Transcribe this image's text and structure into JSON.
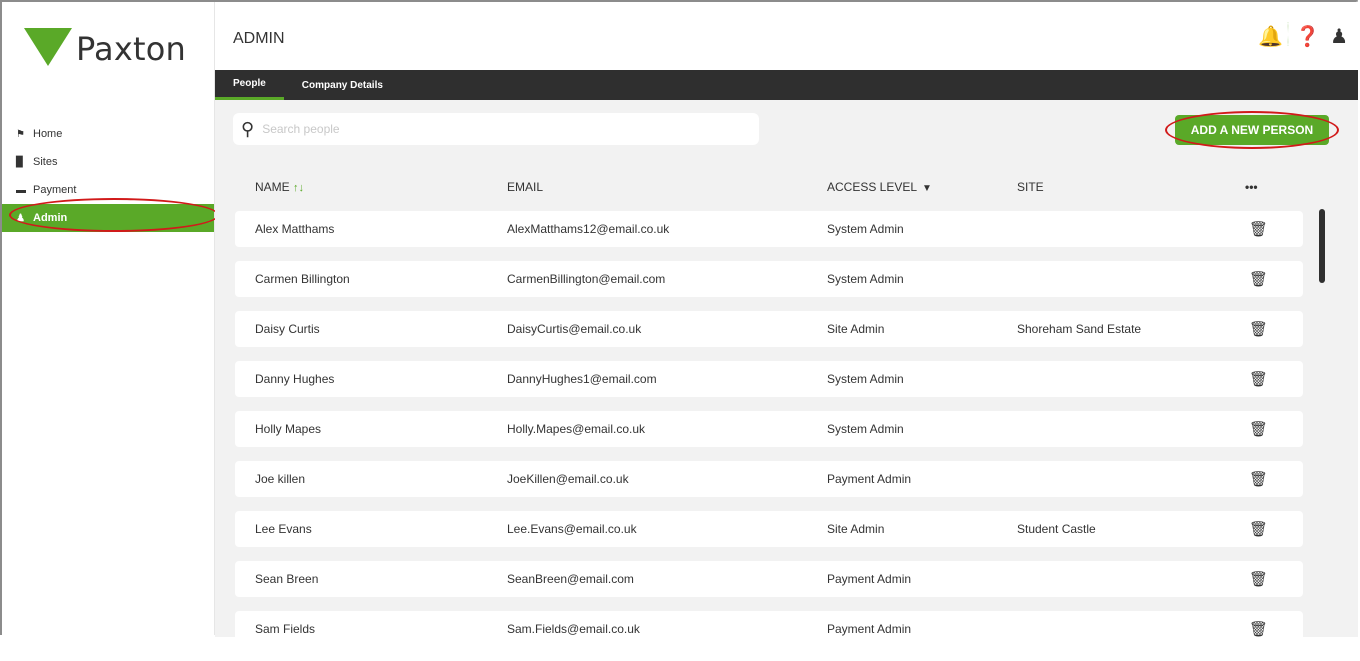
{
  "brand": {
    "name": "Paxton",
    "color": "#5aa928"
  },
  "sidebar": {
    "items": [
      {
        "label": "Home",
        "icon": "home-icon"
      },
      {
        "label": "Sites",
        "icon": "sites-icon"
      },
      {
        "label": "Payment",
        "icon": "payment-icon"
      },
      {
        "label": "Admin",
        "icon": "user-icon",
        "active": true
      }
    ]
  },
  "header": {
    "title": "ADMIN",
    "icons": [
      "bell-icon",
      "help-icon",
      "user-icon"
    ]
  },
  "tabs": [
    {
      "label": "People",
      "active": true
    },
    {
      "label": "Company Details"
    }
  ],
  "search": {
    "placeholder": "Search people",
    "value": ""
  },
  "add_button": {
    "label": "ADD A NEW PERSON"
  },
  "table": {
    "headers": {
      "name": "NAME",
      "email": "EMAIL",
      "access": "ACCESS LEVEL",
      "site": "SITE",
      "more": "•••"
    },
    "rows": [
      {
        "name": "Alex Matthams",
        "email": "AlexMatthams12@email.co.uk",
        "access": "System Admin",
        "site": ""
      },
      {
        "name": "Carmen Billington",
        "email": "CarmenBillington@email.com",
        "access": "System Admin",
        "site": ""
      },
      {
        "name": "Daisy Curtis",
        "email": "DaisyCurtis@email.co.uk",
        "access": "Site Admin",
        "site": "Shoreham Sand Estate"
      },
      {
        "name": "Danny Hughes",
        "email": "DannyHughes1@email.com",
        "access": "System Admin",
        "site": ""
      },
      {
        "name": "Holly Mapes",
        "email": "Holly.Mapes@email.co.uk",
        "access": "System Admin",
        "site": ""
      },
      {
        "name": "Joe killen",
        "email": "JoeKillen@email.co.uk",
        "access": "Payment Admin",
        "site": ""
      },
      {
        "name": "Lee Evans",
        "email": "Lee.Evans@email.co.uk",
        "access": "Site Admin",
        "site": "Student Castle"
      },
      {
        "name": "Sean Breen",
        "email": "SeanBreen@email.com",
        "access": "Payment Admin",
        "site": ""
      },
      {
        "name": "Sam Fields",
        "email": "Sam.Fields@email.co.uk",
        "access": "Payment Admin",
        "site": ""
      }
    ]
  }
}
